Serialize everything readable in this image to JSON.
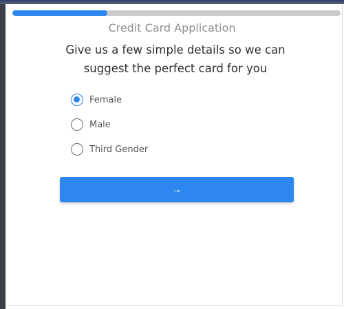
{
  "progress": {
    "fraction": 0.29,
    "fill_color": "#2e87ef",
    "track_color": "#c9cacc"
  },
  "form": {
    "title": "Credit Card Application",
    "subtitle": "Give us a few simple details so we can suggest the perfect card for you"
  },
  "gender_options": [
    {
      "label": "Female",
      "selected": true
    },
    {
      "label": "Male",
      "selected": false
    },
    {
      "label": "Third Gender",
      "selected": false
    }
  ],
  "next_button": {
    "icon": "arrow-right-icon",
    "glyph": "→",
    "color": "#2e87ef"
  }
}
